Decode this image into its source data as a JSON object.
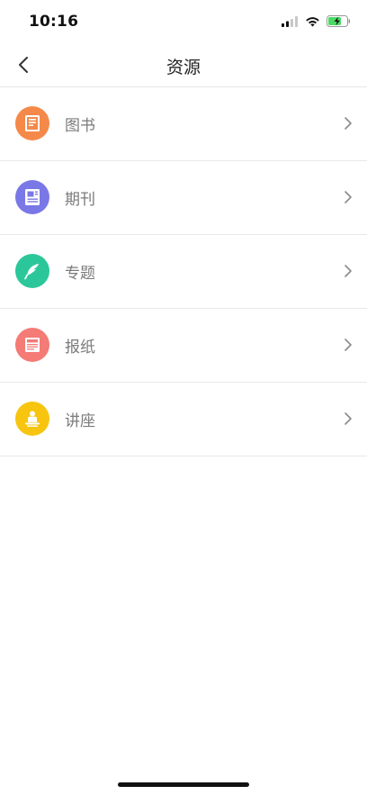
{
  "status_bar": {
    "time": "10:16"
  },
  "nav": {
    "title": "资源",
    "back_icon": "chevron-left-icon"
  },
  "resources": [
    {
      "label": "图书",
      "icon": "book-icon",
      "color": "#F5894A"
    },
    {
      "label": "期刊",
      "icon": "journal-icon",
      "color": "#7A78E6"
    },
    {
      "label": "专题",
      "icon": "feather-icon",
      "color": "#2BC79A"
    },
    {
      "label": "报纸",
      "icon": "newspaper-icon",
      "color": "#F47B76"
    },
    {
      "label": "讲座",
      "icon": "lecture-icon",
      "color": "#F7C510"
    }
  ],
  "colors": {
    "chevron": "#8a8a8a",
    "divider": "#e8e8e8",
    "battery_fill": "#4CD964"
  }
}
